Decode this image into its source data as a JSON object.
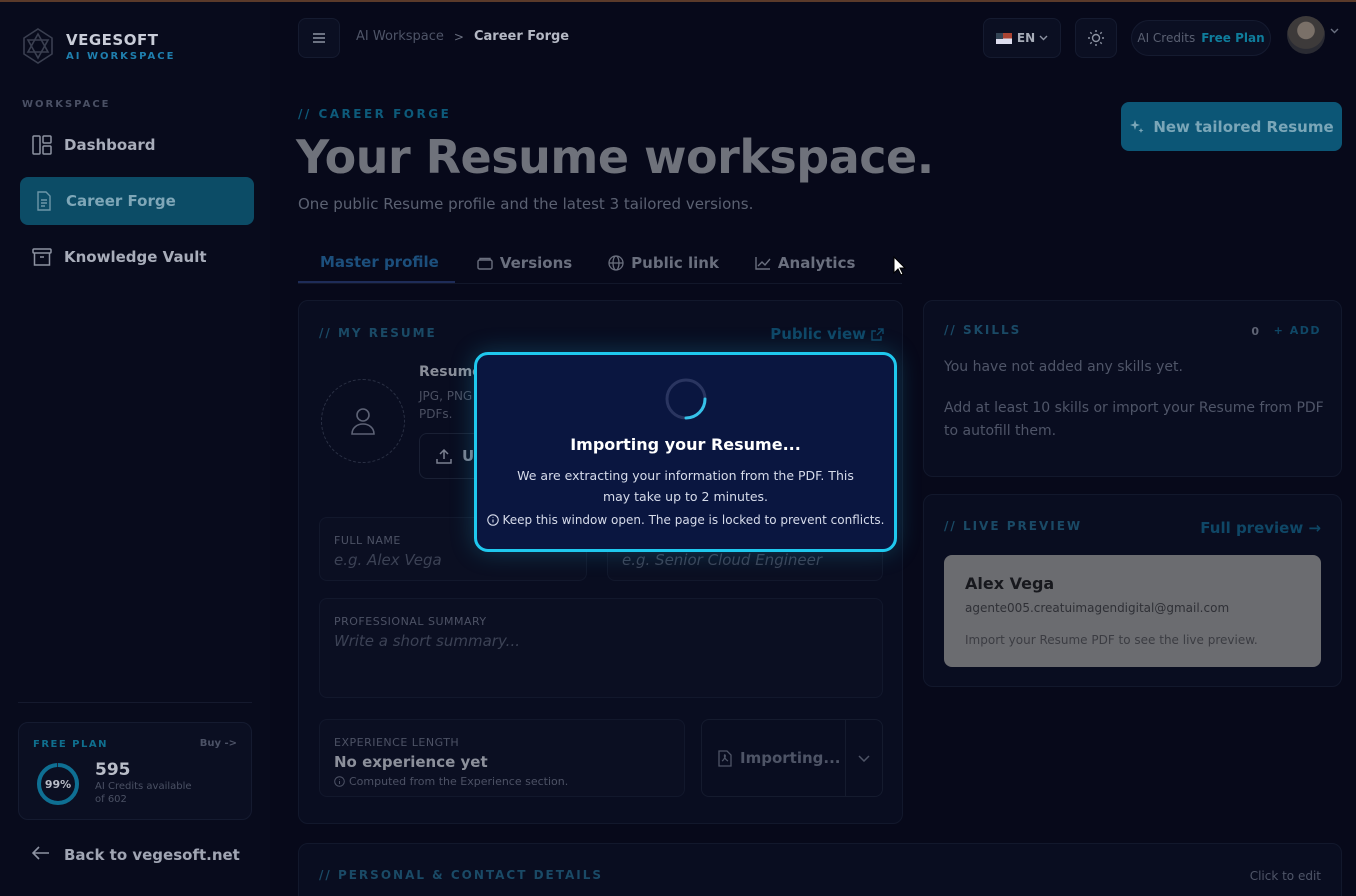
{
  "brand": {
    "name": "VEGESOFT",
    "sub": "AI WORKSPACE"
  },
  "sidebar": {
    "section_label": "WORKSPACE",
    "items": [
      {
        "label": "Dashboard",
        "icon": "dashboard-icon",
        "active": false
      },
      {
        "label": "Career Forge",
        "icon": "document-icon",
        "active": true
      },
      {
        "label": "Knowledge Vault",
        "icon": "archive-icon",
        "active": false
      }
    ],
    "plan": {
      "label": "FREE PLAN",
      "buy": "Buy ->",
      "percent_text": "99%",
      "percent_value": 99,
      "credits": "595",
      "credits_sub": "AI Credits available of 602"
    },
    "back_label": "Back to vegesoft.net"
  },
  "topbar": {
    "breadcrumb": [
      "AI Workspace",
      "Career Forge"
    ],
    "language": "EN",
    "credits_label": "AI Credits",
    "plan_label": "Free Plan"
  },
  "header": {
    "eyebrow": "// CAREER FORGE",
    "title": "Your Resume workspace.",
    "subtitle": "One public Resume profile and the latest 3 tailored versions.",
    "new_button": "New tailored Resume"
  },
  "tabs": [
    {
      "label": "Master profile",
      "icon": "",
      "active": true
    },
    {
      "label": "Versions",
      "icon": "layers-icon",
      "active": false
    },
    {
      "label": "Public link",
      "icon": "globe-icon",
      "active": false
    },
    {
      "label": "Analytics",
      "icon": "chart-icon",
      "active": false
    }
  ],
  "resume_card": {
    "label": "// MY RESUME",
    "public_view": "Public view",
    "photo_title": "Resume",
    "photo_sub": "JPG, PNG PDFs.",
    "upload_label": "U",
    "full_name_label": "FULL NAME",
    "full_name_placeholder": "e.g. Alex Vega",
    "headline_placeholder": "e.g. Senior Cloud Engineer",
    "summary_label": "PROFESSIONAL SUMMARY",
    "summary_placeholder": "Write a short summary...",
    "experience_label": "EXPERIENCE LENGTH",
    "experience_value": "No experience yet",
    "experience_note": "Computed from the Experience section.",
    "importing_label": "Importing..."
  },
  "skills_card": {
    "label": "// SKILLS",
    "count": "0",
    "add": "+ ADD",
    "empty_text": "You have not added any skills yet.",
    "hint": "Add at least 10 skills or import your Resume from PDF to autofill them."
  },
  "preview_card": {
    "label": "// LIVE PREVIEW",
    "full_preview": "Full preview →",
    "name": "Alex Vega",
    "email": "agente005.creatuimagendigital@gmail.com",
    "note": "Import your Resume PDF to see the live preview."
  },
  "personal_card": {
    "label": "// PERSONAL & CONTACT DETAILS",
    "click_edit": "Click to edit"
  },
  "modal": {
    "title": "Importing your Resume...",
    "description": "We are extracting your information from the PDF. This may take up to 2 minutes.",
    "note": "Keep this window open. The page is locked to prevent conflicts."
  },
  "colors": {
    "accent": "#1fc8ee",
    "modal_bg": "#0a1640",
    "page_bg": "#07091a"
  }
}
